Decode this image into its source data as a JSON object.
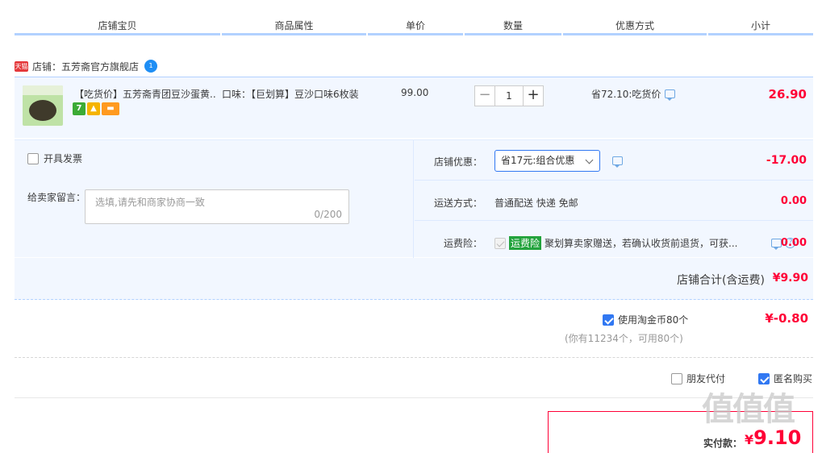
{
  "header": {
    "columns": [
      "店铺宝贝",
      "商品属性",
      "单价",
      "数量",
      "优惠方式",
      "小计"
    ]
  },
  "shop": {
    "badge": "天猫",
    "name": "店铺：五芳斋官方旗舰店",
    "chat_badge": "1"
  },
  "item": {
    "title": "【吃货价】五芳斋青团豆沙蛋黄...",
    "attr": "口味：【巨划算】豆沙口味6枚装",
    "price": "99.00",
    "quantity": "1",
    "minus": "−",
    "plus": "+",
    "promo": "省72.10:吃货价",
    "subtotal": "26.90",
    "badge_seven": "7"
  },
  "options": {
    "invoice_label": "开具发票",
    "memo_label": "给卖家留言：",
    "memo_placeholder": "选填,请先和商家协商一致",
    "memo_count": "0/200",
    "store_discount_label": "店铺优惠：",
    "store_discount_select": "省17元:组合优惠",
    "store_discount_amount": "-17.00",
    "shipping_label": "运送方式：",
    "shipping_value": "普通配送 快递 免邮",
    "shipping_amount": "0.00",
    "insurance_label": "运费险：",
    "insurance_badge": "运费险",
    "insurance_text": "聚划算卖家赠送，若确认收货前退货，可获...",
    "insurance_help": "?",
    "insurance_amount": "0.00"
  },
  "shop_total": {
    "label": "店铺合计(含运费)",
    "value": "¥9.90"
  },
  "coins": {
    "label": "使用淘金币80个",
    "note": "(你有11234个，可用80个)",
    "value": "¥-0.80"
  },
  "extras": {
    "friend_pay": "朋友代付",
    "anonymous": "匿名购买"
  },
  "pay": {
    "label": "实付款：",
    "currency": "¥",
    "value": "9.10"
  },
  "watermark": "值值值",
  "colors": {
    "accent_red": "#ff0036",
    "accent_blue": "#3178f2",
    "panel_bg": "#f2f7ff",
    "header_line": "#b2d1ff"
  }
}
